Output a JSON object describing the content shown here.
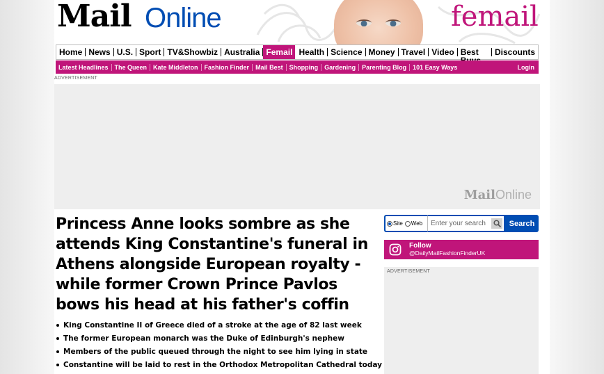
{
  "masthead": {
    "logo_mail": "Mail",
    "logo_online": "Online",
    "section_logo": "femail"
  },
  "nav": {
    "primary": [
      "Home",
      "News",
      "U.S.",
      "Sport",
      "TV&Showbiz",
      "Australia",
      "Femail",
      "Health",
      "Science",
      "Money",
      "Travel",
      "Video",
      "Best Buys",
      "Discounts"
    ],
    "active": "Femail",
    "secondary": [
      "Latest Headlines",
      "The Queen",
      "Kate Middleton",
      "Fashion Finder",
      "Mail Best",
      "Shopping",
      "Gardening",
      "Parenting Blog",
      "101 Easy Ways"
    ],
    "login": "Login"
  },
  "ads": {
    "label": "ADVERTISEMENT",
    "logo_mail": "Mail",
    "logo_online": "Online"
  },
  "article": {
    "headline": "Princess Anne looks sombre as she attends King Constantine's funeral in Athens alongside European royalty - while former Crown Prince Pavlos bows his head at his father's coffin",
    "bullets": [
      "King Constantine II of Greece died of a stroke at the age of 82 last week",
      "The former European monarch was the Duke of Edinburgh's nephew",
      "Members of the public queued through the night to see him lying in state",
      "Constantine will be laid to rest in the Orthodox Metropolitan Cathedral today"
    ]
  },
  "search": {
    "option_site": "Site",
    "option_web": "Web",
    "placeholder": "Enter your search",
    "button": "Search"
  },
  "follow": {
    "label": "Follow",
    "handle": "@DailyMailFashionFinderUK"
  },
  "colors": {
    "femail_pink": "#c0157a",
    "mail_blue": "#004db3",
    "ad_gray": "#eeeeee"
  }
}
